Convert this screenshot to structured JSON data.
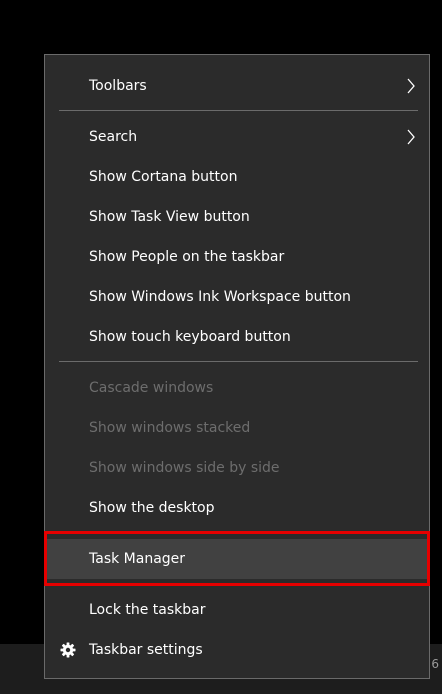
{
  "context_menu": {
    "items": [
      {
        "label": "Toolbars",
        "enabled": true,
        "submenu": true
      },
      {
        "label": "Search",
        "enabled": true,
        "submenu": true
      },
      {
        "label": "Show Cortana button",
        "enabled": true
      },
      {
        "label": "Show Task View button",
        "enabled": true
      },
      {
        "label": "Show People on the taskbar",
        "enabled": true
      },
      {
        "label": "Show Windows Ink Workspace button",
        "enabled": true
      },
      {
        "label": "Show touch keyboard button",
        "enabled": true
      },
      {
        "label": "Cascade windows",
        "enabled": false
      },
      {
        "label": "Show windows stacked",
        "enabled": false
      },
      {
        "label": "Show windows side by side",
        "enabled": false
      },
      {
        "label": "Show the desktop",
        "enabled": true
      },
      {
        "label": "Task Manager",
        "enabled": true,
        "highlighted": true
      },
      {
        "label": "Lock the taskbar",
        "enabled": true
      },
      {
        "label": "Taskbar settings",
        "enabled": true,
        "icon": "gear-icon"
      }
    ],
    "icons": {
      "submenu_indicator": "chevron-right-icon",
      "settings": "gear-icon"
    }
  },
  "taskbar": {
    "tray_glyph": "6"
  },
  "colors": {
    "menu_background": "#2b2b2b",
    "menu_text": "#ffffff",
    "disabled_text": "#6d6d6d",
    "hover_background": "#414141",
    "highlight_border": "#e60000",
    "taskbar_background": "#1d1d1d"
  }
}
